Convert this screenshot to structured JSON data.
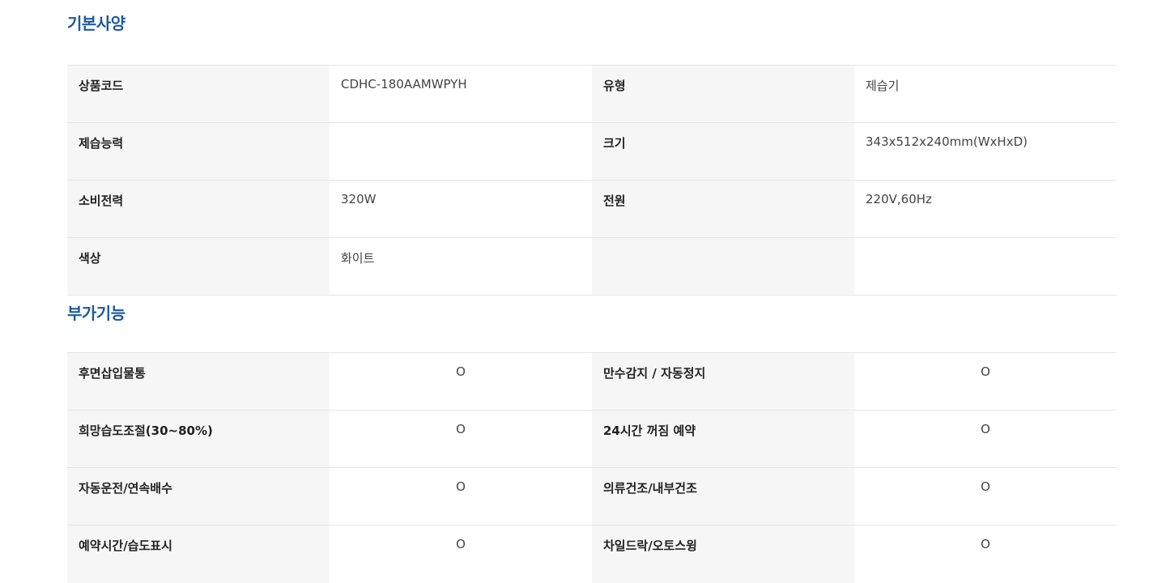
{
  "basic_specs": {
    "title": "기본사양",
    "rows": [
      [
        {
          "label": "상품코드",
          "value": "CDHC-180AAMWPYH"
        },
        {
          "label": "유형",
          "value": "제습기"
        }
      ],
      [
        {
          "label": "제습능력",
          "value": ""
        },
        {
          "label": "크기",
          "value": "343x512x240mm(WxHxD)"
        }
      ],
      [
        {
          "label": "소비전력",
          "value": "320W"
        },
        {
          "label": "전원",
          "value": "220V,60Hz"
        }
      ],
      [
        {
          "label": "색상",
          "value": "화이트"
        },
        {
          "label": "",
          "value": ""
        }
      ]
    ]
  },
  "extra_features": {
    "title": "부가기능",
    "rows": [
      [
        {
          "label": "후면삽입물통",
          "value": "O"
        },
        {
          "label": "만수감지 / 자동정지",
          "value": "O"
        }
      ],
      [
        {
          "label": "희망습도조절(30~80%)",
          "value": "O"
        },
        {
          "label": "24시간 꺼짐 예약",
          "value": "O"
        }
      ],
      [
        {
          "label": "자동운전/연속배수",
          "value": "O"
        },
        {
          "label": "의류건조/내부건조",
          "value": "O"
        }
      ],
      [
        {
          "label": "예약시간/습도표시",
          "value": "O"
        },
        {
          "label": "차일드락/오토스윙",
          "value": "O"
        }
      ]
    ]
  }
}
